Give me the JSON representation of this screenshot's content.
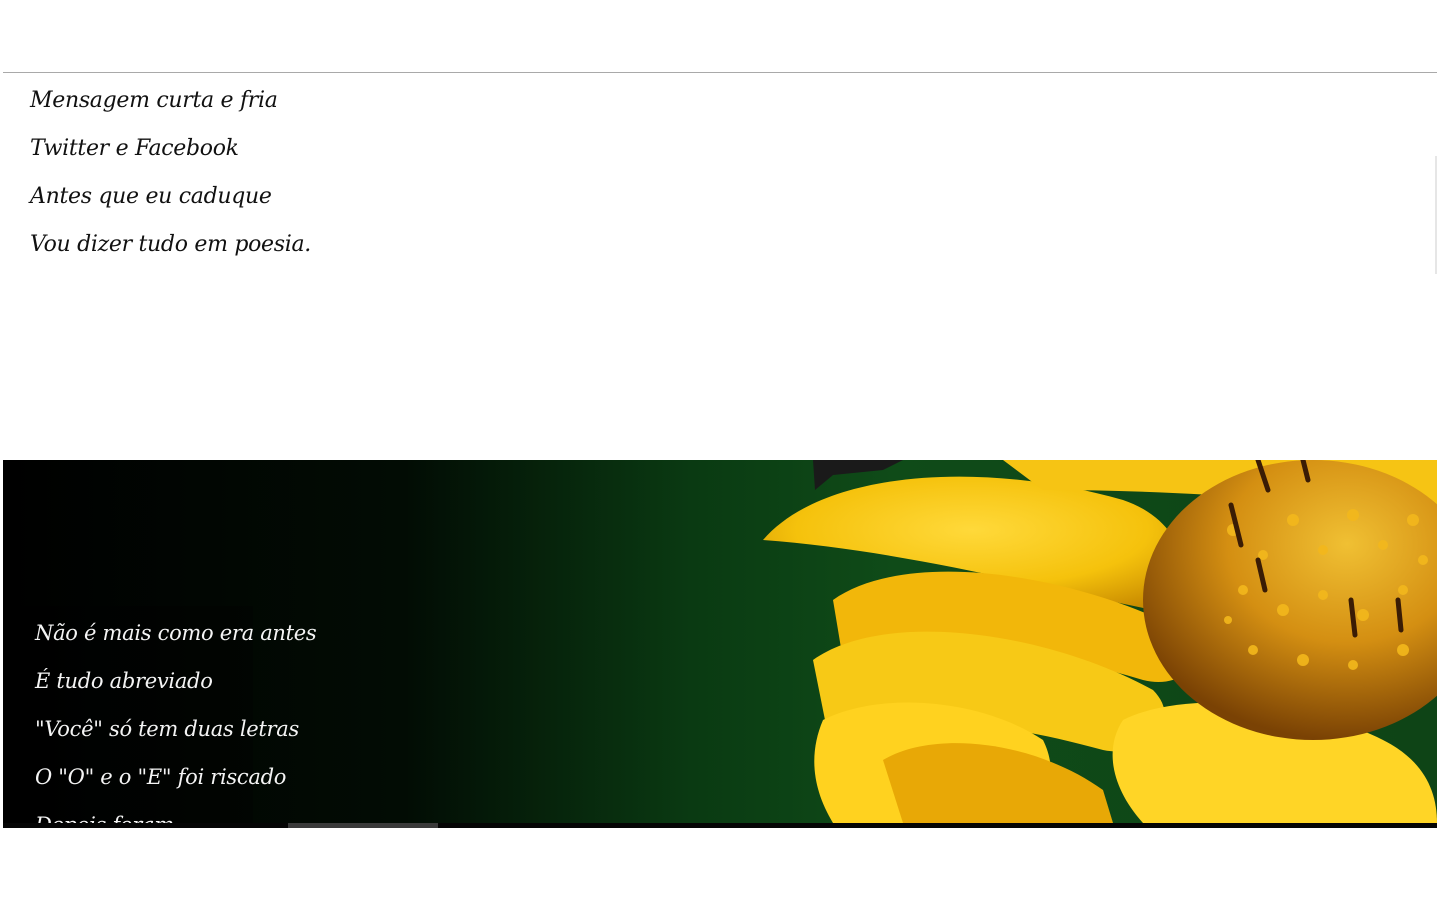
{
  "poem_top": {
    "lines": [
      "Mensagem curta e fria",
      "Twitter e Facebook",
      "Antes que eu caduque",
      "Vou dizer tudo em poesia."
    ]
  },
  "banner": {
    "image": "yellow-flower-photo",
    "lines": [
      "Não é mais como era antes",
      "É tudo abreviado",
      "\"Você\" só tem duas letras",
      "O \"O\" e o \"E\" foi riscado",
      "Depois foram"
    ]
  }
}
